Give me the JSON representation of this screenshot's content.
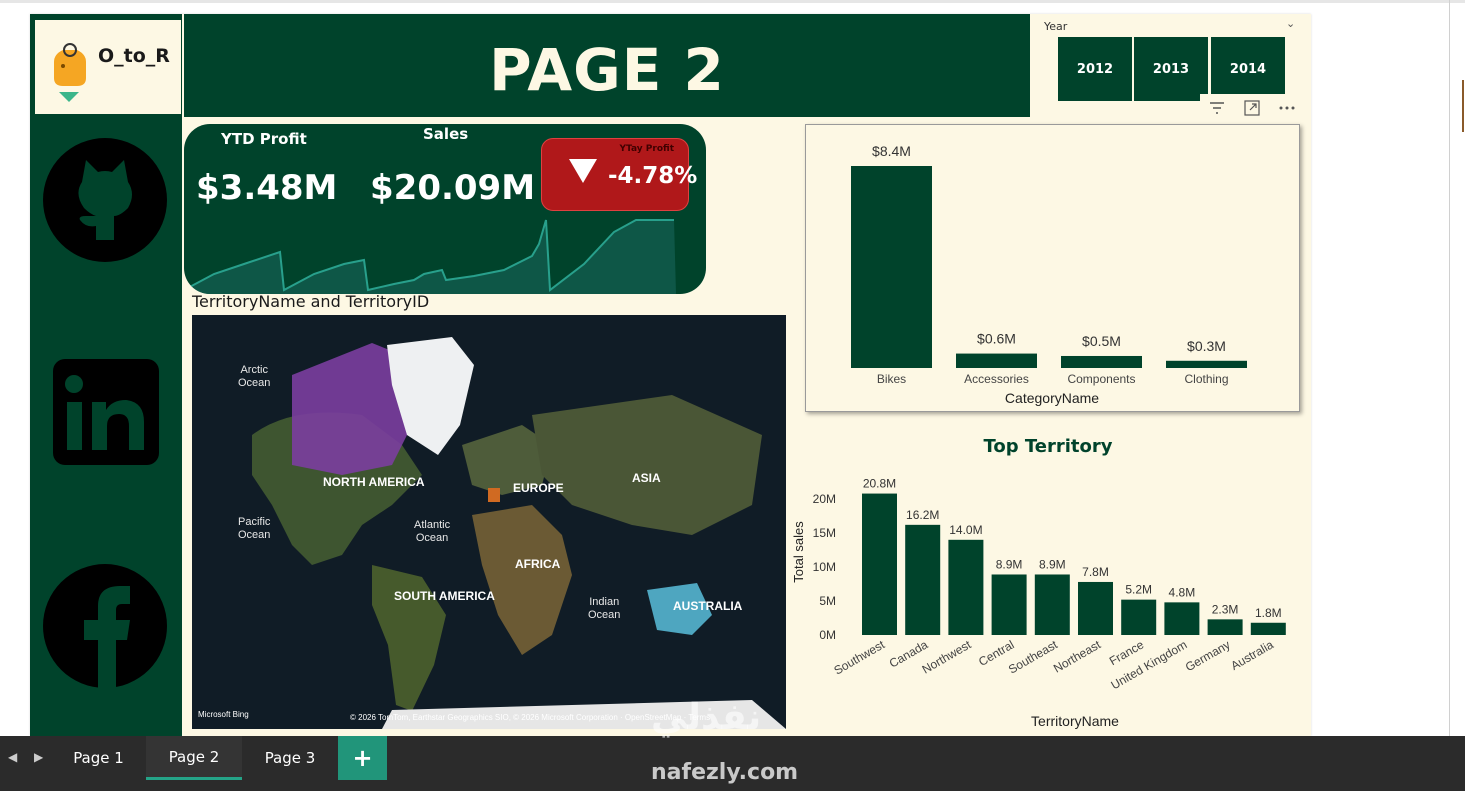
{
  "logo": {
    "text": "O_to_R"
  },
  "banner": {
    "title": "PAGE 2"
  },
  "slicer": {
    "label": "Year",
    "years": [
      "2012",
      "2013",
      "2014"
    ]
  },
  "kpi": {
    "profit_label": "YTD Profit",
    "profit_value": "$3.48M",
    "sales_label": "Sales",
    "sales_value": "$20.09M",
    "yoy_label": "YTay Profit",
    "yoy_value": "-4.78%"
  },
  "map": {
    "title": "TerritoryName and TerritoryID",
    "labels": {
      "arctic": "Arctic\nOcean",
      "pacific": "Pacific\nOcean",
      "atlantic": "Atlantic\nOcean",
      "indian": "Indian\nOcean",
      "north_america": "NORTH AMERICA",
      "south_america": "SOUTH AMERICA",
      "europe": "EUROPE",
      "africa": "AFRICA",
      "asia": "ASIA",
      "australia": "AUSTRALIA"
    },
    "bing": "Microsoft Bing",
    "attribution": "© 2026 TomTom, Earthstar Geographics SIO, © 2026 Microsoft Corporation · OpenStreetMap · Terms"
  },
  "icons": [
    "github-icon",
    "linkedin-icon",
    "facebook-icon",
    "filter-icon",
    "focus-mode-icon",
    "more-options-icon"
  ],
  "colors": {
    "brand": "#00432b",
    "canvas": "#fdf8e4",
    "negative": "#b0181a",
    "accent": "#24a488"
  },
  "chart_data": [
    {
      "type": "bar",
      "categories": [
        "Bikes",
        "Accessories",
        "Components",
        "Clothing"
      ],
      "values": [
        8.4,
        0.6,
        0.5,
        0.3
      ],
      "data_labels": [
        "$8.4M",
        "$0.6M",
        "$0.5M",
        "$0.3M"
      ],
      "xlabel": "CategoryName",
      "ylabel": "",
      "ylim": [
        0,
        8.4
      ]
    },
    {
      "type": "bar",
      "title": "Top Territory",
      "categories": [
        "Southwest",
        "Canada",
        "Northwest",
        "Central",
        "Southeast",
        "Northeast",
        "France",
        "United Kingdom",
        "Germany",
        "Australia"
      ],
      "values": [
        20.8,
        16.2,
        14.0,
        8.9,
        8.9,
        7.8,
        5.2,
        4.8,
        2.3,
        1.8
      ],
      "data_labels": [
        "20.8M",
        "16.2M",
        "14.0M",
        "8.9M",
        "8.9M",
        "7.8M",
        "5.2M",
        "4.8M",
        "2.3M",
        "1.8M"
      ],
      "xlabel": "TerritoryName",
      "ylabel": "Total sales",
      "yticks": [
        "0M",
        "5M",
        "10M",
        "15M",
        "20M"
      ],
      "ylim": [
        0,
        20
      ],
      "grid": false
    }
  ],
  "tabs": {
    "page1": "Page 1",
    "page2": "Page 2",
    "page3": "Page 3",
    "add": "+"
  },
  "watermark": {
    "arabic": "نفذلي",
    "url": "nafezly.com"
  }
}
